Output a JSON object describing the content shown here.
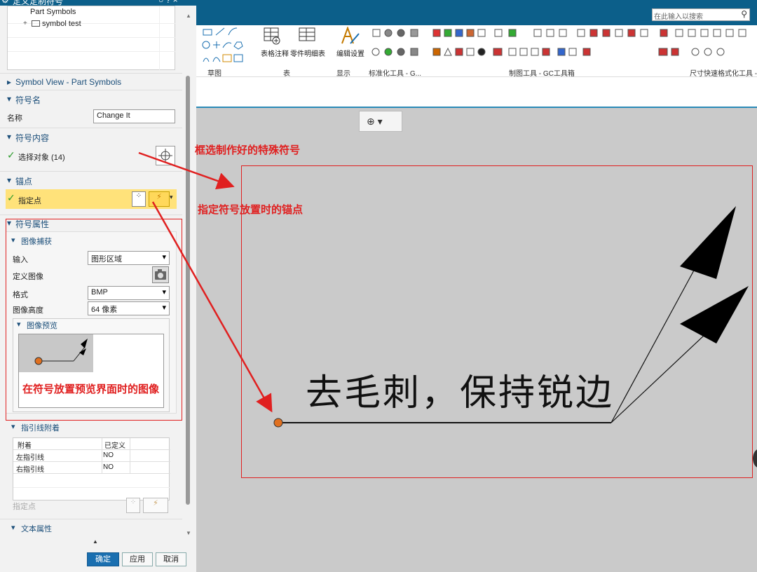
{
  "dialog": {
    "title": "定义定制符号",
    "title_icons": "○ ? ×",
    "tree": {
      "items": [
        "Part Symbols",
        "symbol test"
      ]
    },
    "symbol_view_label": "Symbol View - Part Symbols",
    "symbol_name": {
      "header": "符号名",
      "field_label": "名称",
      "value": "Change It"
    },
    "symbol_content": {
      "header": "符号内容",
      "select_label": "选择对象 (14)"
    },
    "anchor": {
      "header": "锚点",
      "specify_point_label": "指定点"
    },
    "symbol_attrs": {
      "header": "符号属性",
      "image_capture": {
        "header": "图像捕获",
        "input_label": "输入",
        "input_value": "图形区域",
        "define_image_label": "定义图像",
        "format_label": "格式",
        "format_value": "BMP",
        "height_label": "图像高度",
        "height_value": "64 像素",
        "preview_header": "图像预览"
      }
    },
    "leader_attach": {
      "header": "指引线附着",
      "columns": [
        "附着",
        "已定义"
      ],
      "rows": [
        [
          "左指引线",
          "NO"
        ],
        [
          "右指引线",
          "NO"
        ]
      ],
      "specify_point_label": "指定点"
    },
    "text_attrs_header": "文本属性",
    "buttons": {
      "ok": "确定",
      "apply": "应用",
      "cancel": "取消"
    }
  },
  "ribbon": {
    "search_placeholder": "在此输入以搜索",
    "labels": {
      "table_note": "表格注释",
      "parts_list": "零件明细表",
      "edit_settings": "编辑设置"
    },
    "groups": [
      "草图",
      "表",
      "显示",
      "标准化工具 - G...",
      "制图工具 - GC工具箱",
      "尺寸快速格式化工具 - G"
    ]
  },
  "canvas": {
    "symbol_text": "去毛刺，保持锐边",
    "snap_menu": "⊕ ▾"
  },
  "annotations": {
    "select": "框选制作好的特殊符号",
    "anchor": "指定符号放置时的锚点",
    "preview": "在符号放置预览界面时的图像"
  },
  "colors": {
    "accent": "#0c5f8a",
    "annotation_red": "#e02020",
    "anchor_fill": "#ffe27a"
  }
}
